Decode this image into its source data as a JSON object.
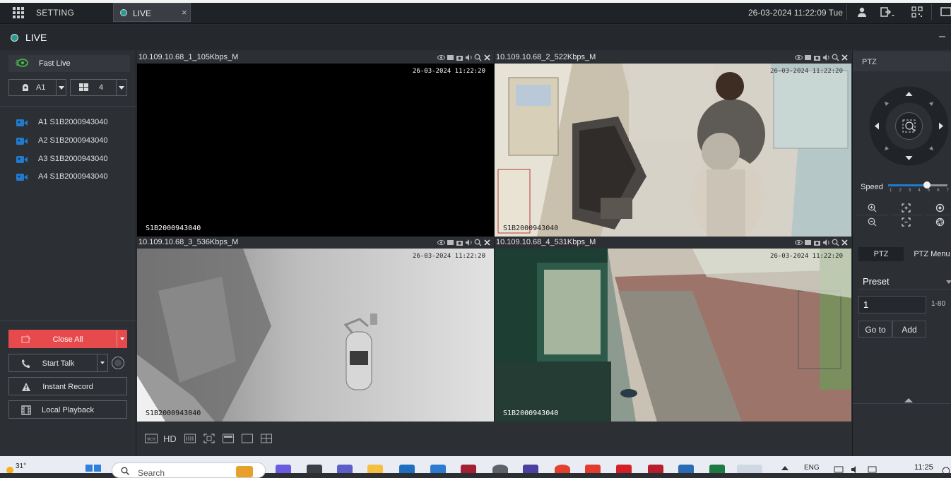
{
  "topbar": {
    "setting_label": "SETTING",
    "live_tab_label": "LIVE",
    "close_glyph": "×",
    "datetime": "26-03-2024 11:22:09 Tue",
    "icons": [
      "user-icon",
      "logout-icon",
      "qr-code-icon",
      "monitor-icon"
    ]
  },
  "live_header": {
    "title": "LIVE",
    "minimize_glyph": "–"
  },
  "left_panel": {
    "fast_live_label": "Fast Live",
    "device_select": {
      "value": "A1"
    },
    "layout_select": {
      "value": "4"
    },
    "cameras": [
      {
        "label": "A1 S1B2000943040"
      },
      {
        "label": "A2 S1B2000943040"
      },
      {
        "label": "A3 S1B2000943040"
      },
      {
        "label": "A4 S1B2000943040"
      }
    ],
    "buttons": {
      "close_all": "Close All",
      "start_talk": "Start Talk",
      "instant_record": "Instant Record",
      "local_playback": "Local Playback"
    }
  },
  "tiles": [
    {
      "title": "10.109.10.68_1_105Kbps_M",
      "osd_time": "26-03-2024 11:22:20",
      "osd_id": "S1B2000943040"
    },
    {
      "title": "10.109.10.68_2_522Kbps_M",
      "osd_time": "26-03-2024 11:22:20",
      "osd_id": "S1B2000943040"
    },
    {
      "title": "10.109.10.68_3_536Kbps_M",
      "osd_time": "26-03-2024 11:22:20",
      "osd_id": "S1B2000943040"
    },
    {
      "title": "10.109.10.68_4_531Kbps_M",
      "osd_time": "26-03-2024 11:22:20",
      "osd_id": "S1B2000943040"
    }
  ],
  "grid_toolbar": {
    "hd_label": "HD",
    "wh_label": "W:H"
  },
  "ptz": {
    "header": "PTZ",
    "speed_label": "Speed",
    "speed_value": 5,
    "speed_ticks": [
      "1",
      "2",
      "3",
      "4",
      "5",
      "6",
      "7"
    ],
    "tabs": [
      "PTZ",
      "PTZ Menu"
    ],
    "preset_select": "Preset",
    "preset_value": "1",
    "preset_range": "1-80",
    "goto_label": "Go to",
    "add_label": "Add"
  },
  "taskbar": {
    "temperature": "31°",
    "search_placeholder": "Search",
    "language": "ENG",
    "clock": "11:25"
  },
  "colors": {
    "accent_blue": "#1f7bd0",
    "close_all_red": "#e64a4d",
    "active_tile_green": "#43c147",
    "live_dot": "#2a9a8f"
  }
}
